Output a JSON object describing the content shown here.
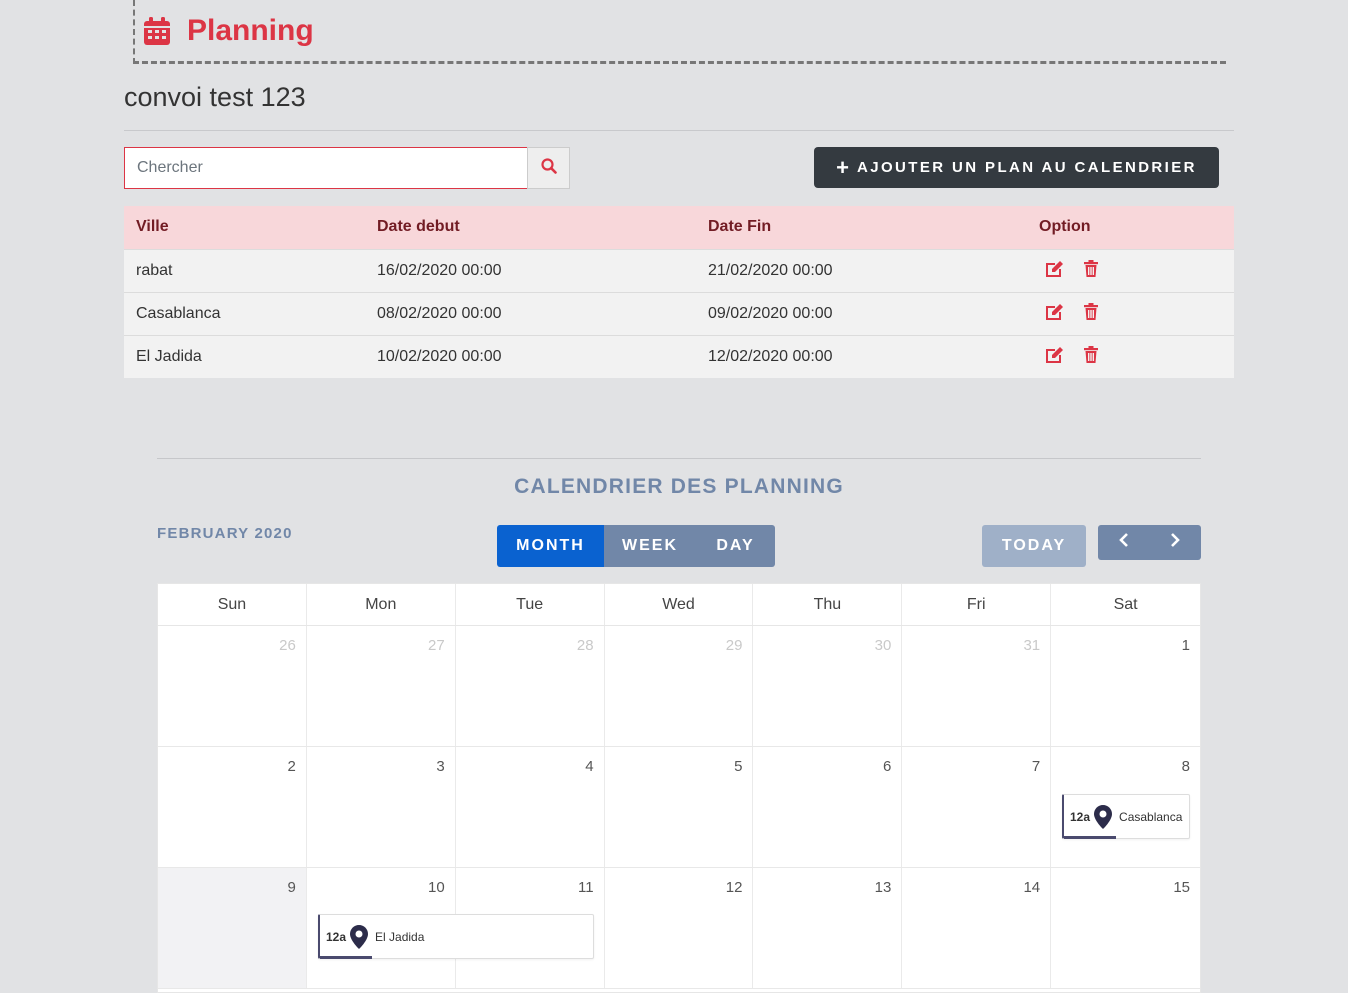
{
  "header": {
    "title": "Planning",
    "icon": "calendar-icon",
    "accent": "#dc3545"
  },
  "convoy": {
    "name": "convoi test 123"
  },
  "search": {
    "placeholder": "Chercher",
    "value": ""
  },
  "actions": {
    "add_label": "AJOUTER UN PLAN AU CALENDRIER"
  },
  "table": {
    "headers": [
      "Ville",
      "Date debut",
      "Date Fin",
      "Option"
    ],
    "rows": [
      {
        "ville": "rabat",
        "debut": "16/02/2020 00:00",
        "fin": "21/02/2020 00:00"
      },
      {
        "ville": "Casablanca",
        "debut": "08/02/2020 00:00",
        "fin": "09/02/2020 00:00"
      },
      {
        "ville": "El Jadida",
        "debut": "10/02/2020 00:00",
        "fin": "12/02/2020 00:00"
      }
    ]
  },
  "calendar": {
    "title": "CALENDRIER DES PLANNING",
    "month_label": "FEBRUARY 2020",
    "views": [
      "MONTH",
      "WEEK",
      "DAY"
    ],
    "active_view": "MONTH",
    "today_label": "TODAY",
    "weekdays": [
      "Sun",
      "Mon",
      "Tue",
      "Wed",
      "Thu",
      "Fri",
      "Sat"
    ],
    "weeks": [
      [
        "26",
        "27",
        "28",
        "29",
        "30",
        "31",
        "1"
      ],
      [
        "2",
        "3",
        "4",
        "5",
        "6",
        "7",
        "8"
      ],
      [
        "9",
        "10",
        "11",
        "12",
        "13",
        "14",
        "15"
      ]
    ],
    "events": [
      {
        "time": "12a",
        "title": "Casablanca"
      },
      {
        "time": "12a",
        "title": "El Jadida"
      }
    ]
  }
}
